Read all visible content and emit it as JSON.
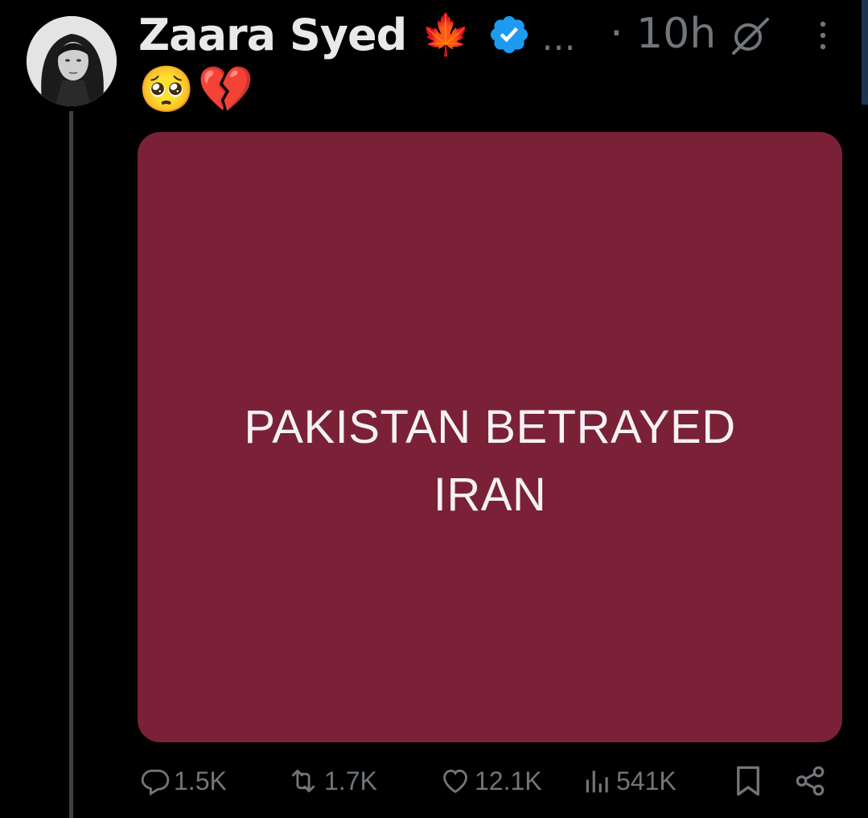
{
  "post": {
    "author_name": "Zaara Syed",
    "name_emoji": "🍁",
    "overflow_indicator": "...",
    "timestamp": "· 10h",
    "status_emojis": "🥺💔",
    "media": {
      "line1": "PAKISTAN BETRAYED",
      "line2": "IRAN",
      "background_color": "#7a2137"
    },
    "actions": {
      "replies": "1.5K",
      "reposts": "1.7K",
      "likes": "12.1K",
      "views": "541K"
    }
  },
  "icons": {
    "verified": "verified-badge-icon",
    "grok": "grok-icon",
    "more": "more-options-icon",
    "reply": "reply-icon",
    "repost": "repost-icon",
    "like": "heart-icon",
    "views": "views-icon",
    "bookmark": "bookmark-icon",
    "share": "share-icon"
  },
  "colors": {
    "background": "#000000",
    "primary_text": "#e7e9ea",
    "secondary_text": "#71767b",
    "verified_blue": "#1d9bf0"
  }
}
